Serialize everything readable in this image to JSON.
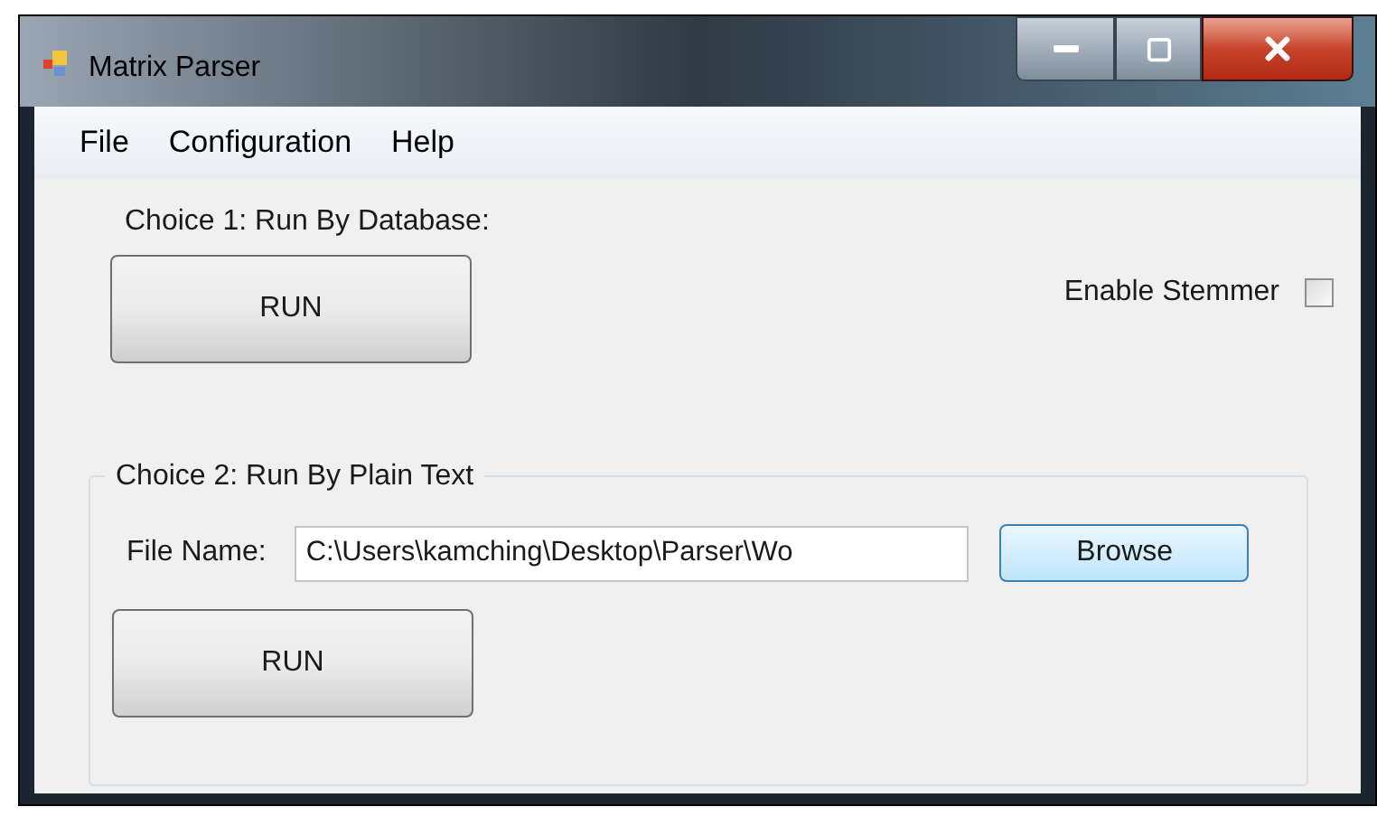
{
  "window": {
    "title": "Matrix Parser"
  },
  "menu": [
    "File",
    "Configuration",
    "Help"
  ],
  "choice_1": {
    "label": "Choice 1: Run By Database:",
    "button": "RUN"
  },
  "stemmer": {
    "label": "Enable Stemmer",
    "checked": false
  },
  "choice_2": {
    "title": "Choice 2: Run By Plain Text",
    "file_label": "File Name:",
    "file_value": "C:\\Users\\kamching\\Desktop\\Parser\\Wo",
    "browse": "Browse",
    "button": "RUN"
  }
}
